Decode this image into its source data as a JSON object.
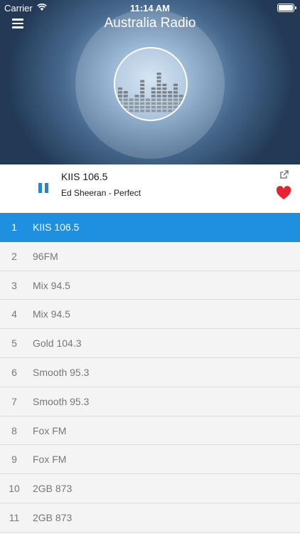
{
  "status_bar": {
    "carrier": "Carrier",
    "time": "11:14 AM"
  },
  "header": {
    "title": "Australia Radio",
    "menu_icon": "hamburger-menu-icon",
    "logo_icon": "equalizer-logo-icon"
  },
  "now_playing": {
    "station": "KIIS 106.5",
    "track": "Ed Sheeran - Perfect",
    "play_state_icon": "pause-icon",
    "share_icon": "share-external-icon",
    "favorite_icon": "heart-icon",
    "favorite_color": "#e8232f"
  },
  "colors": {
    "accent": "#1f8fe0",
    "pause": "#2a86c8"
  },
  "stations": [
    {
      "num": "1",
      "name": "KIIS 106.5",
      "active": true
    },
    {
      "num": "2",
      "name": "96FM"
    },
    {
      "num": "3",
      "name": "Mix 94.5"
    },
    {
      "num": "4",
      "name": "Mix 94.5"
    },
    {
      "num": "5",
      "name": "Gold 104.3"
    },
    {
      "num": "6",
      "name": "Smooth 95.3"
    },
    {
      "num": "7",
      "name": "Smooth 95.3"
    },
    {
      "num": "8",
      "name": "Fox FM"
    },
    {
      "num": "9",
      "name": "Fox FM"
    },
    {
      "num": "10",
      "name": "2GB 873"
    },
    {
      "num": "11",
      "name": "2GB 873"
    }
  ]
}
